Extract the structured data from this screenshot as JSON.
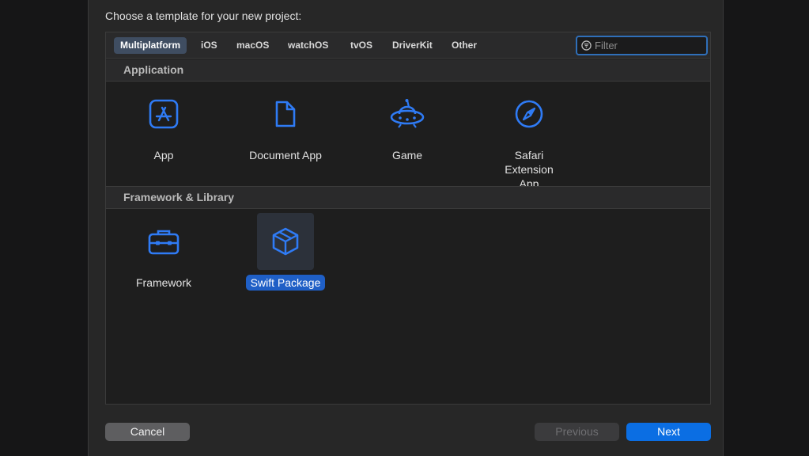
{
  "dialog": {
    "prompt": "Choose a template for your new project:"
  },
  "tabs": [
    {
      "label": "Multiplatform",
      "active": true
    },
    {
      "label": "iOS",
      "active": false
    },
    {
      "label": "macOS",
      "active": false
    },
    {
      "label": "watchOS",
      "active": false
    },
    {
      "label": "tvOS",
      "active": false
    },
    {
      "label": "DriverKit",
      "active": false
    },
    {
      "label": "Other",
      "active": false
    }
  ],
  "filter": {
    "placeholder": "Filter",
    "value": "",
    "icon": "filter-icon"
  },
  "sections": [
    {
      "title": "Application",
      "items": [
        {
          "label": "App",
          "icon": "app-store-icon",
          "selected": false
        },
        {
          "label": "Document App",
          "icon": "document-icon",
          "selected": false
        },
        {
          "label": "Game",
          "icon": "game-ufo-icon",
          "selected": false
        },
        {
          "label": "Safari Extension\nApp",
          "icon": "compass-icon",
          "selected": false
        }
      ]
    },
    {
      "title": "Framework & Library",
      "items": [
        {
          "label": "Framework",
          "icon": "toolbox-icon",
          "selected": false
        },
        {
          "label": "Swift Package",
          "icon": "package-box-icon",
          "selected": true
        }
      ]
    }
  ],
  "buttons": {
    "cancel": "Cancel",
    "previous": "Previous",
    "next": "Next"
  },
  "colors": {
    "accent": "#0b6ee3",
    "icon": "#2f7bf5",
    "selected_label": "#1f5fc6"
  }
}
